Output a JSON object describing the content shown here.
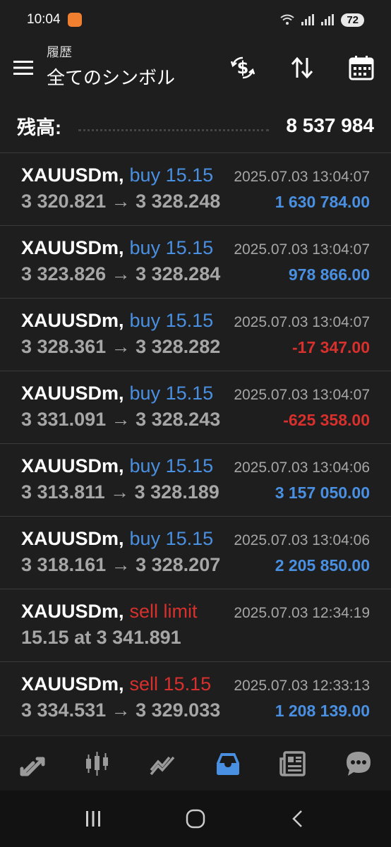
{
  "status": {
    "time": "10:04",
    "battery": "72"
  },
  "header": {
    "subtitle": "履歴",
    "title": "全てのシンボル"
  },
  "balance": {
    "label": "残高:",
    "value": "8 537 984"
  },
  "trades": [
    {
      "symbol": "XAUUSDm,",
      "side": "buy 15.15",
      "side_type": "buy",
      "time": "2025.07.03 13:04:07",
      "prices": "3 320.821 → 3 328.248",
      "profit": "1 630 784.00",
      "profit_type": "pos"
    },
    {
      "symbol": "XAUUSDm,",
      "side": "buy 15.15",
      "side_type": "buy",
      "time": "2025.07.03 13:04:07",
      "prices": "3 323.826 → 3 328.284",
      "profit": "978 866.00",
      "profit_type": "pos"
    },
    {
      "symbol": "XAUUSDm,",
      "side": "buy 15.15",
      "side_type": "buy",
      "time": "2025.07.03 13:04:07",
      "prices": "3 328.361 → 3 328.282",
      "profit": "-17 347.00",
      "profit_type": "neg"
    },
    {
      "symbol": "XAUUSDm,",
      "side": "buy 15.15",
      "side_type": "buy",
      "time": "2025.07.03 13:04:07",
      "prices": "3 331.091 → 3 328.243",
      "profit": "-625 358.00",
      "profit_type": "neg"
    },
    {
      "symbol": "XAUUSDm,",
      "side": "buy 15.15",
      "side_type": "buy",
      "time": "2025.07.03 13:04:06",
      "prices": "3 313.811 → 3 328.189",
      "profit": "3 157 050.00",
      "profit_type": "pos"
    },
    {
      "symbol": "XAUUSDm,",
      "side": "buy 15.15",
      "side_type": "buy",
      "time": "2025.07.03 13:04:06",
      "prices": "3 318.161 → 3 328.207",
      "profit": "2 205 850.00",
      "profit_type": "pos"
    },
    {
      "symbol": "XAUUSDm,",
      "side": "sell limit",
      "side_type": "sell",
      "time": "2025.07.03 12:34:19",
      "prices": "15.15 at 3 341.891",
      "profit": "",
      "profit_type": "pos"
    },
    {
      "symbol": "XAUUSDm,",
      "side": "sell 15.15",
      "side_type": "sell",
      "time": "2025.07.03 12:33:13",
      "prices": "3 334.531 → 3 329.033",
      "profit": "1 208 139.00",
      "profit_type": "pos"
    }
  ],
  "icons": {
    "menu": "menu-icon",
    "currency_exchange": "currency-exchange-icon",
    "sort": "sort-icon",
    "calendar": "calendar-icon",
    "nav": [
      "quotes-icon",
      "chart-icon",
      "trade-icon",
      "history-icon",
      "news-icon",
      "chat-icon"
    ]
  },
  "colors": {
    "buy": "#4a90e2",
    "sell": "#d8302c",
    "active_nav": "#4a90e2"
  }
}
